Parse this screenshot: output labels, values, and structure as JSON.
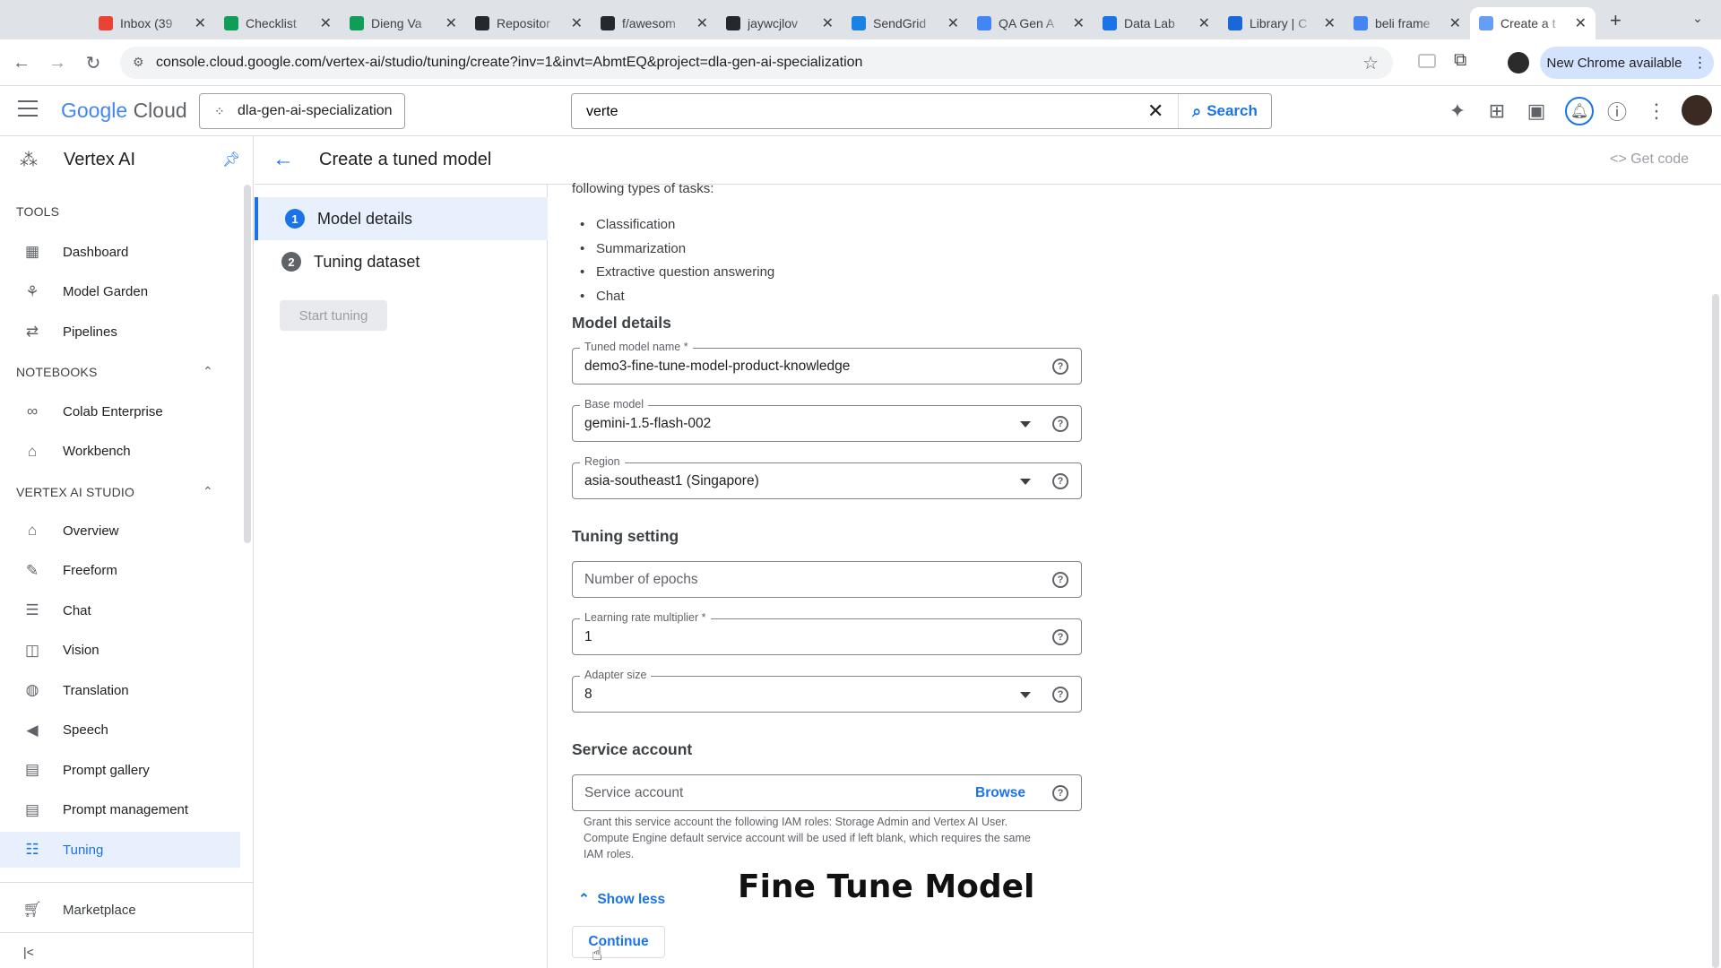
{
  "browser": {
    "tabs": [
      {
        "title": "Inbox (39",
        "icon": "gmail-icon",
        "color": "#ea4335"
      },
      {
        "title": "Checklist",
        "icon": "sheets-icon",
        "color": "#0f9d58"
      },
      {
        "title": "Dieng Va",
        "icon": "sheets-icon",
        "color": "#0f9d58"
      },
      {
        "title": "Repositor",
        "icon": "github-icon",
        "color": "#24292f"
      },
      {
        "title": "f/awesom",
        "icon": "github-icon",
        "color": "#24292f"
      },
      {
        "title": "jaywcjlov",
        "icon": "github-icon",
        "color": "#24292f"
      },
      {
        "title": "SendGrid",
        "icon": "sendgrid-icon",
        "color": "#1a82e2"
      },
      {
        "title": "QA Gen A",
        "icon": "docs-icon",
        "color": "#4285f4"
      },
      {
        "title": "Data Lab",
        "icon": "calendar-icon",
        "color": "#1a73e8"
      },
      {
        "title": "Library | C",
        "icon": "confluence-icon",
        "color": "#1868db"
      },
      {
        "title": "beli frame",
        "icon": "google-icon",
        "color": "#4285f4"
      },
      {
        "title": "Create a t",
        "icon": "vertex-icon",
        "color": "#669df6"
      }
    ],
    "url": "console.cloud.google.com/vertex-ai/studio/tuning/create?inv=1&invt=AbmtEQ&project=dla-gen-ai-specialization",
    "new_chrome_label": "New Chrome available"
  },
  "header": {
    "logo_google": "Google",
    "logo_cloud": "Cloud",
    "project": "dla-gen-ai-specialization",
    "search_value": "verte",
    "search_label": "Search"
  },
  "sidebar": {
    "product": "Vertex AI",
    "tools_label": "TOOLS",
    "tools": [
      "Dashboard",
      "Model Garden",
      "Pipelines"
    ],
    "notebooks_label": "NOTEBOOKS",
    "notebooks": [
      "Colab Enterprise",
      "Workbench"
    ],
    "studio_label": "VERTEX AI STUDIO",
    "studio": [
      "Overview",
      "Freeform",
      "Chat",
      "Vision",
      "Translation",
      "Speech",
      "Prompt gallery",
      "Prompt management",
      "Tuning"
    ],
    "marketplace": "Marketplace"
  },
  "page": {
    "title": "Create a tuned model",
    "get_code": "Get code"
  },
  "stepper": {
    "steps": [
      {
        "num": "1",
        "label": "Model details"
      },
      {
        "num": "2",
        "label": "Tuning dataset"
      }
    ],
    "start_tuning": "Start tuning"
  },
  "form": {
    "intro": "following types of tasks:",
    "tasks": [
      "Classification",
      "Summarization",
      "Extractive question answering",
      "Chat"
    ],
    "model_details_heading": "Model details",
    "tuned_model_name_label": "Tuned model name *",
    "tuned_model_name_value": "demo3-fine-tune-model-product-knowledge",
    "base_model_label": "Base model",
    "base_model_value": "gemini-1.5-flash-002",
    "region_label": "Region",
    "region_value": "asia-southeast1 (Singapore)",
    "tuning_setting_heading": "Tuning setting",
    "epochs_placeholder": "Number of epochs",
    "lr_label": "Learning rate multiplier *",
    "lr_value": "1",
    "adapter_label": "Adapter size",
    "adapter_value": "8",
    "service_account_heading": "Service account",
    "service_account_placeholder": "Service account",
    "browse_label": "Browse",
    "service_account_help": "Grant this service account the following IAM roles: Storage Admin and Vertex AI User. Compute Engine default service account will be used if left blank, which requires the same IAM roles.",
    "show_less": "Show less",
    "continue_label": "Continue"
  },
  "overlay_caption": "Fine Tune Model",
  "colors": {
    "accent": "#1a73e8",
    "selected_bg": "#e8f0fe"
  }
}
